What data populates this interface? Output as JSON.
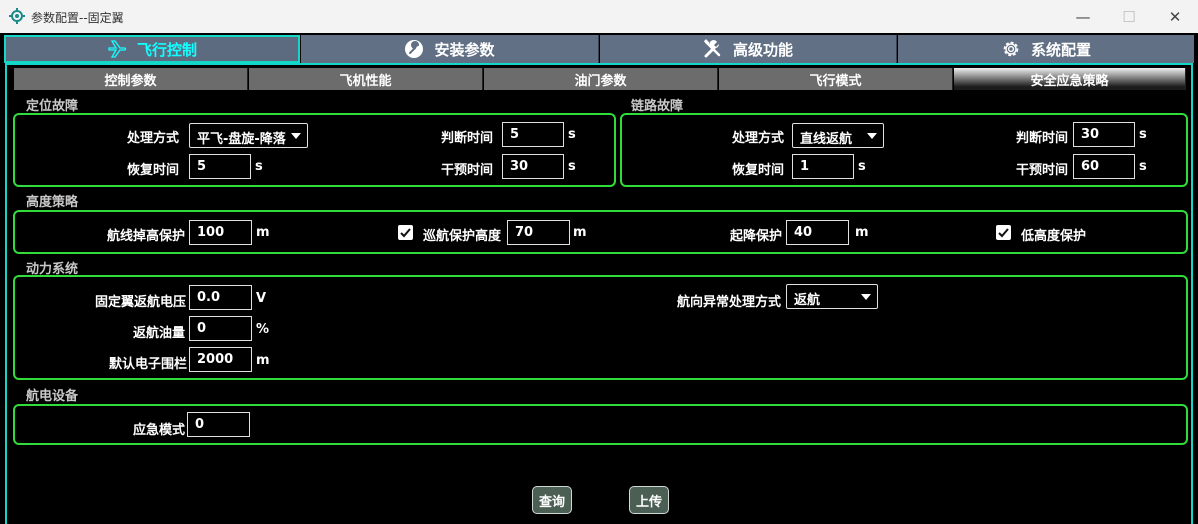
{
  "window": {
    "title": "参数配置--固定翼",
    "minimize": "—",
    "maximize": "☐",
    "close": "✕"
  },
  "main_tabs": [
    {
      "label": "飞行控制",
      "icon": "airplane-icon",
      "active": true
    },
    {
      "label": "安装参数",
      "icon": "wrench-circle-icon",
      "active": false
    },
    {
      "label": "高级功能",
      "icon": "tools-icon",
      "active": false
    },
    {
      "label": "系统配置",
      "icon": "gear-icon",
      "active": false
    }
  ],
  "sub_tabs": [
    {
      "label": "控制参数",
      "active": false
    },
    {
      "label": "飞机性能",
      "active": false
    },
    {
      "label": "油门参数",
      "active": false
    },
    {
      "label": "飞行模式",
      "active": false
    },
    {
      "label": "安全应急策略",
      "active": true
    }
  ],
  "positioning_fault": {
    "title": "定位故障",
    "handling_label": "处理方式",
    "handling_value": "平飞-盘旋-降落",
    "judge_label": "判断时间",
    "judge_value": "5",
    "judge_unit": "s",
    "recover_label": "恢复时间",
    "recover_value": "5",
    "recover_unit": "s",
    "intervene_label": "干预时间",
    "intervene_value": "30",
    "intervene_unit": "s"
  },
  "link_fault": {
    "title": "链路故障",
    "handling_label": "处理方式",
    "handling_value": "直线返航",
    "judge_label": "判断时间",
    "judge_value": "30",
    "judge_unit": "s",
    "recover_label": "恢复时间",
    "recover_value": "1",
    "recover_unit": "s",
    "intervene_label": "干预时间",
    "intervene_value": "60",
    "intervene_unit": "s"
  },
  "altitude": {
    "title": "高度策略",
    "route_drop_label": "航线掉高保护",
    "route_drop_value": "100",
    "route_drop_unit": "m",
    "cruise_label": "巡航保护高度",
    "cruise_checked": true,
    "cruise_value": "70",
    "cruise_unit": "m",
    "takeoff_label": "起降保护",
    "takeoff_value": "40",
    "takeoff_unit": "m",
    "low_alt_label": "低高度保护",
    "low_alt_checked": true
  },
  "power": {
    "title": "动力系统",
    "voltage_label": "固定翼返航电压",
    "voltage_value": "0.0",
    "voltage_unit": "V",
    "fuel_label": "返航油量",
    "fuel_value": "0",
    "fuel_unit": "%",
    "fence_label": "默认电子围栏",
    "fence_value": "2000",
    "fence_unit": "m",
    "heading_label": "航向异常处理方式",
    "heading_value": "返航"
  },
  "avionics": {
    "title": "航电设备",
    "emergency_label": "应急模式",
    "emergency_value": "0"
  },
  "actions": {
    "query": "查询",
    "upload": "上传"
  },
  "colors": {
    "accent": "#15d7c8",
    "group_border": "#2fdc3a",
    "tab_bg": "#627085"
  }
}
